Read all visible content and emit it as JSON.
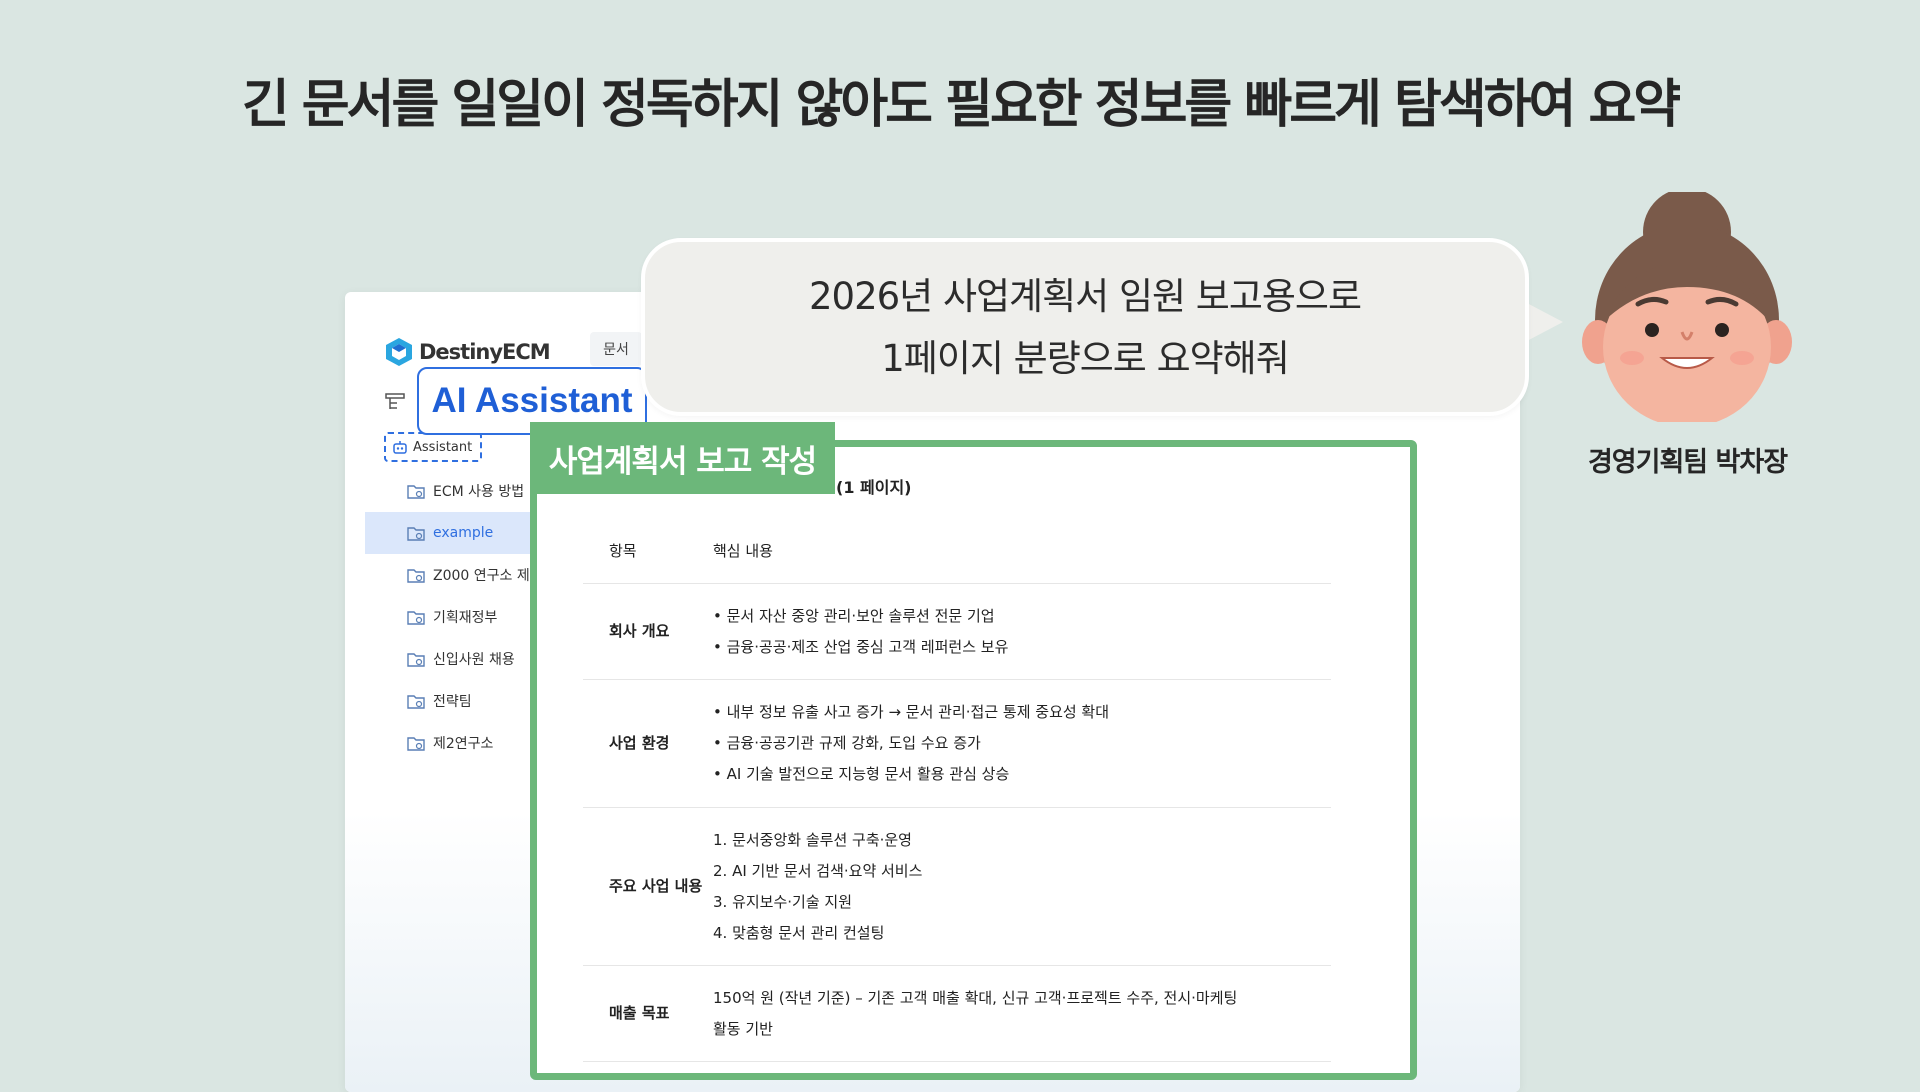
{
  "headline": "긴 문서를 일일이 정독하지 않아도 필요한 정보를 빠르게 탐색하여 요약",
  "app": {
    "logo_text": "DestinyECM",
    "top_tab": "문서",
    "callout": "AI Assistant",
    "assistant_node": "Assistant",
    "sidebar_items": [
      {
        "label": "ECM 사용 방법",
        "active": false
      },
      {
        "label": "example",
        "active": true
      },
      {
        "label": "Z000 연구소 제",
        "active": false
      },
      {
        "label": "기획재정부",
        "active": false
      },
      {
        "label": "신입사원 채용",
        "active": false
      },
      {
        "label": "전략팀",
        "active": false
      },
      {
        "label": "제2연구소",
        "active": false
      }
    ],
    "accent_color": "#2f6fe0"
  },
  "bubble": {
    "line1": "2026년 사업계획서 임원 보고용으로",
    "line2": "1페이지 분량으로 요약해줘"
  },
  "avatar": {
    "caption": "경영기획팀 박차장"
  },
  "report": {
    "tag": "사업계획서 보고 작성",
    "title_tail": "(1 페이지)",
    "accent_color": "#6cb77a",
    "header": {
      "key": "항목",
      "value": "핵심 내용"
    },
    "rows": [
      {
        "key": "회사 개요",
        "lines": [
          "• 문서 자산 중앙 관리·보안 솔루션 전문 기업",
          "• 금융·공공·제조 산업 중심 고객 레퍼런스 보유"
        ]
      },
      {
        "key": "사업 환경",
        "lines": [
          "• 내부 정보 유출 사고 증가 → 문서 관리·접근 통제 중요성 확대",
          "• 금융·공공기관 규제 강화, 도입 수요 증가",
          "• AI 기술 발전으로 지능형 문서 활용 관심 상승"
        ]
      },
      {
        "key": "주요 사업 내용",
        "lines": [
          "1. 문서중앙화 솔루션 구축·운영",
          "2. AI 기반 문서 검색·요약 서비스",
          "3. 유지보수·기술 지원",
          "4. 맞춤형 문서 관리 컨설팅"
        ]
      },
      {
        "key": "매출 목표",
        "lines": [
          "150억 원 (작년 기준) – 기존 고객 매출 확대, 신규 고객·프로젝트 수주, 전시·마케팅",
          "활동 기반"
        ]
      }
    ]
  }
}
